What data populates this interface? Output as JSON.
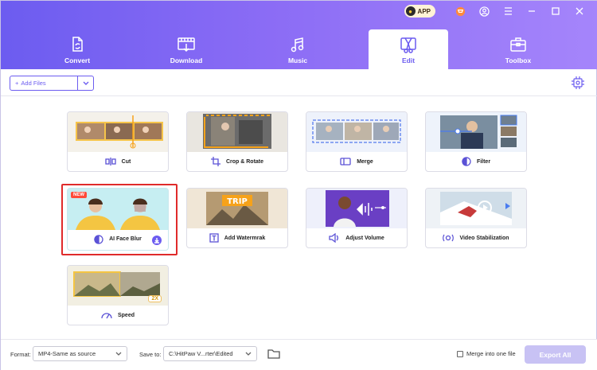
{
  "titlebar": {
    "app_badge": "APP",
    "icons": [
      "cart-icon",
      "account-icon",
      "menu-icon",
      "minimize-icon",
      "maximize-icon",
      "close-icon"
    ]
  },
  "tabs": [
    {
      "label": "Convert",
      "icon": "convert-icon",
      "active": false
    },
    {
      "label": "Download",
      "icon": "download-film-icon",
      "active": false
    },
    {
      "label": "Music",
      "icon": "music-note-icon",
      "active": false
    },
    {
      "label": "Edit",
      "icon": "edit-scissors-icon",
      "active": true
    },
    {
      "label": "Toolbox",
      "icon": "toolbox-icon",
      "active": false
    }
  ],
  "toolbar": {
    "add_files_label": "Add Files",
    "settings_icon": "hardware-acceleration-icon"
  },
  "cards": [
    {
      "label": "Cut",
      "icon": "cut-icon"
    },
    {
      "label": "Crop & Rotate",
      "icon": "crop-icon"
    },
    {
      "label": "Merge",
      "icon": "merge-icon"
    },
    {
      "label": "Filter",
      "icon": "filter-icon"
    },
    {
      "label": "AI Face Blur",
      "icon": "face-blur-icon",
      "tag": "NEW",
      "selected": true
    },
    {
      "label": "Add Watermrak",
      "icon": "watermark-icon",
      "thumb_text": "TRIP"
    },
    {
      "label": "Adjust Volume",
      "icon": "volume-icon"
    },
    {
      "label": "Video Stabilization",
      "icon": "stabilization-icon"
    },
    {
      "label": "Speed",
      "icon": "speed-icon",
      "tag": "2X"
    }
  ],
  "footer": {
    "format_label": "Format:",
    "format_value": "MP4-Same as source",
    "save_to_label": "Save to:",
    "save_to_value": "C:\\HitPaw V...rter\\Edited",
    "merge_label": "Merge into one file",
    "merge_checked": false,
    "export_label": "Export All"
  },
  "colors": {
    "accent": "#6c5cf0",
    "highlight": "#e02b2b",
    "export_disabled": "#c8c2f4"
  }
}
